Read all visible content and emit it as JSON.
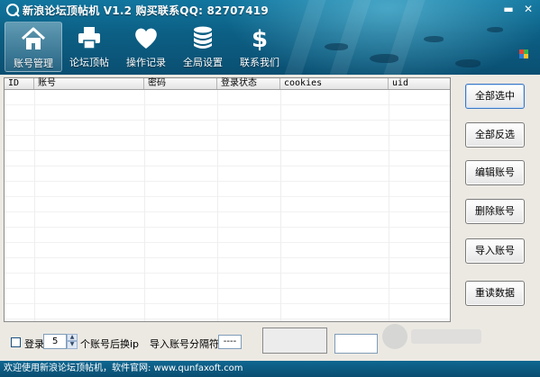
{
  "window": {
    "title": "新浪论坛顶帖机 V1.2 购买联系QQ: 82707419",
    "controls": [
      "minimize-icon",
      "close-icon"
    ]
  },
  "nav": {
    "items": [
      {
        "label": "账号管理",
        "icon": "house-icon",
        "active": true
      },
      {
        "label": "论坛顶帖",
        "icon": "printer-icon",
        "active": false
      },
      {
        "label": "操作记录",
        "icon": "heart-icon",
        "active": false
      },
      {
        "label": "全局设置",
        "icon": "database-icon",
        "active": false
      },
      {
        "label": "联系我们",
        "icon": "dollar-icon",
        "active": false
      }
    ]
  },
  "grid": {
    "columns": [
      "ID",
      "账号",
      "密码",
      "登录状态",
      "cookies",
      "uid"
    ],
    "rows": []
  },
  "side_buttons": [
    "全部选中",
    "全部反选",
    "编辑账号",
    "删除账号",
    "导入账号",
    "重读数据"
  ],
  "bottom": {
    "login_label": "登录",
    "login_checked": false,
    "count_value": "5",
    "switch_label": "个账号后换ip",
    "separator_label": "导入账号分隔符:",
    "separator_value": "----"
  },
  "status_bar": {
    "text": "欢迎使用新浪论坛顶帖机，软件官网: www.qunfaxoft.com"
  },
  "colors": {
    "header": "#0c5f84",
    "status_bar": "#0a4e71",
    "window_bg": "#ece9e3"
  }
}
